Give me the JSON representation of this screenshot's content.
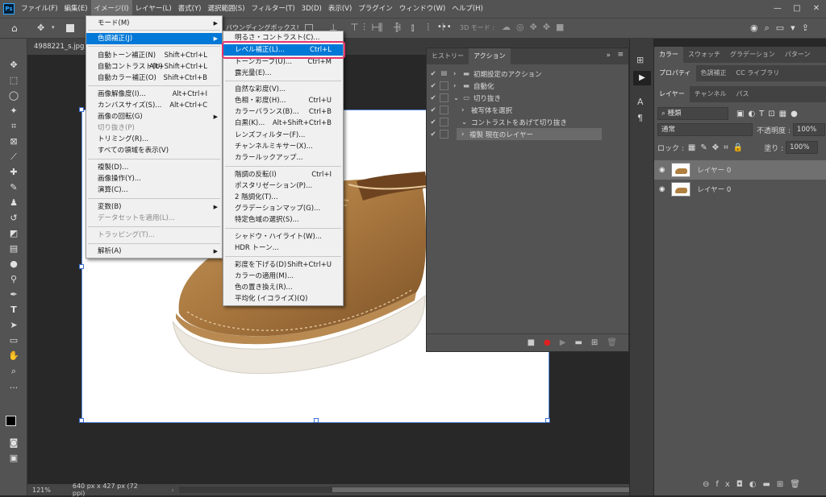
{
  "app": {
    "logo": "Ps"
  },
  "menubar": {
    "items": [
      "ファイル(F)",
      "編集(E)",
      "イメージ(I)",
      "レイヤー(L)",
      "書式(Y)",
      "選択範囲(S)",
      "フィルター(T)",
      "3D(D)",
      "表示(V)",
      "プラグイン",
      "ウィンドウ(W)",
      "ヘルプ(H)"
    ]
  },
  "window_controls": {
    "minimize": "—",
    "maximize": "□",
    "close": "✕"
  },
  "options_bar": {
    "bbox_label": "バウンディングボックスを表示",
    "mode_3d": "3D モード :",
    "more": "•••"
  },
  "document": {
    "tab": "4988221_s.jpg @ 121% (レイヤー 0, RGB/8)",
    "zoom": "121%",
    "info": "640 px x 427 px (72 ppi)"
  },
  "image_menu": {
    "items": [
      {
        "label": "モード(M)",
        "shortcut": "",
        "sub": true
      },
      {
        "label": "色調補正(J)",
        "shortcut": "",
        "sub": true,
        "highlight": true
      },
      {
        "label": "自動トーン補正(N)",
        "shortcut": "Shift+Ctrl+L"
      },
      {
        "label": "自動コントラスト(U)",
        "shortcut": "Alt+Shift+Ctrl+L"
      },
      {
        "label": "自動カラー補正(O)",
        "shortcut": "Shift+Ctrl+B"
      },
      {
        "label": "画像解像度(I)...",
        "shortcut": "Alt+Ctrl+I"
      },
      {
        "label": "カンバスサイズ(S)...",
        "shortcut": "Alt+Ctrl+C"
      },
      {
        "label": "画像の回転(G)",
        "shortcut": "",
        "sub": true
      },
      {
        "label": "切り抜き(P)",
        "shortcut": "",
        "disabled": true
      },
      {
        "label": "トリミング(R)...",
        "shortcut": ""
      },
      {
        "label": "すべての領域を表示(V)",
        "shortcut": ""
      },
      {
        "label": "複製(D)...",
        "shortcut": ""
      },
      {
        "label": "画像操作(Y)...",
        "shortcut": ""
      },
      {
        "label": "演算(C)...",
        "shortcut": ""
      },
      {
        "label": "変数(B)",
        "shortcut": "",
        "sub": true
      },
      {
        "label": "データセットを適用(L)...",
        "shortcut": "",
        "disabled": true
      },
      {
        "label": "トラッピング(T)...",
        "shortcut": "",
        "disabled": true
      },
      {
        "label": "解析(A)",
        "shortcut": "",
        "sub": true
      }
    ]
  },
  "adjust_menu": {
    "items": [
      {
        "label": "明るさ・コントラスト(C)...",
        "shortcut": ""
      },
      {
        "label": "レベル補正(L)...",
        "shortcut": "Ctrl+L",
        "highlight": true
      },
      {
        "label": "トーンカーブ(U)...",
        "shortcut": "Ctrl+M"
      },
      {
        "label": "露光量(E)...",
        "shortcut": ""
      },
      {
        "label": "自然な彩度(V)...",
        "shortcut": ""
      },
      {
        "label": "色相・彩度(H)...",
        "shortcut": "Ctrl+U"
      },
      {
        "label": "カラーバランス(B)...",
        "shortcut": "Ctrl+B"
      },
      {
        "label": "白黒(K)...",
        "shortcut": "Alt+Shift+Ctrl+B"
      },
      {
        "label": "レンズフィルター(F)...",
        "shortcut": ""
      },
      {
        "label": "チャンネルミキサー(X)...",
        "shortcut": ""
      },
      {
        "label": "カラールックアップ...",
        "shortcut": ""
      },
      {
        "label": "階調の反転(I)",
        "shortcut": "Ctrl+I"
      },
      {
        "label": "ポスタリゼーション(P)...",
        "shortcut": ""
      },
      {
        "label": "2 階調化(T)...",
        "shortcut": ""
      },
      {
        "label": "グラデーションマップ(G)...",
        "shortcut": ""
      },
      {
        "label": "特定色域の選択(S)...",
        "shortcut": ""
      },
      {
        "label": "シャドウ・ハイライト(W)...",
        "shortcut": ""
      },
      {
        "label": "HDR トーン...",
        "shortcut": ""
      },
      {
        "label": "彩度を下げる(D)",
        "shortcut": "Shift+Ctrl+U"
      },
      {
        "label": "カラーの適用(M)...",
        "shortcut": ""
      },
      {
        "label": "色の置き換え(R)...",
        "shortcut": ""
      },
      {
        "label": "平均化 (イコライズ)(Q)",
        "shortcut": ""
      }
    ]
  },
  "actions_panel": {
    "tabs": [
      "ヒストリー",
      "アクション"
    ],
    "rows": [
      {
        "label": "初期設定のアクション",
        "level": 0,
        "checked": true
      },
      {
        "label": "自動化",
        "level": 0,
        "checked": true
      },
      {
        "label": "切り抜き",
        "level": 0,
        "checked": true,
        "open": true
      },
      {
        "label": "被写体を選択",
        "level": 1,
        "checked": true
      },
      {
        "label": "コントラストをあげて切り抜き",
        "level": 1,
        "checked": true,
        "open": true
      },
      {
        "label": "複製 現在のレイヤー",
        "level": 2,
        "checked": true,
        "selected": true
      }
    ]
  },
  "right_panel": {
    "tabs_top": [
      "カラー",
      "スウォッチ",
      "グラデーション",
      "パターン"
    ],
    "tabs_mid": [
      "プロパティ",
      "色調補正",
      "CC ライブラリ"
    ],
    "tabs_layers": [
      "レイヤー",
      "チャンネル",
      "パス"
    ],
    "filter_label": "種類",
    "blend_mode": "通常",
    "opacity_label": "不透明度 :",
    "opacity": "100%",
    "lock_label": "ロック :",
    "fill_label": "塗り :",
    "fill": "100%",
    "layers": [
      {
        "name": "レイヤー 0",
        "selected": true
      },
      {
        "name": "レイヤー 0",
        "selected": false
      }
    ]
  }
}
